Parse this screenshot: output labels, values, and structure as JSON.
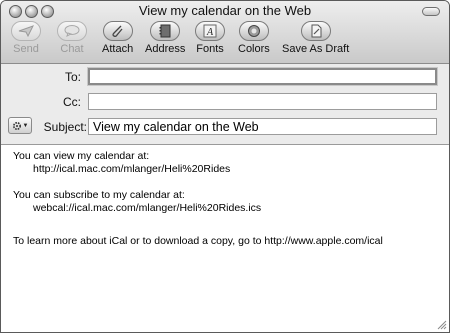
{
  "window": {
    "title": "View my calendar on the Web"
  },
  "toolbar": {
    "send": "Send",
    "chat": "Chat",
    "attach": "Attach",
    "address": "Address",
    "fonts": "Fonts",
    "colors": "Colors",
    "save_as_draft": "Save As Draft"
  },
  "headers": {
    "to_label": "To:",
    "to_value": "",
    "cc_label": "Cc:",
    "cc_value": "",
    "subject_label": "Subject:",
    "subject_value": "View my calendar on the Web"
  },
  "message": {
    "line1": "You can view my calendar at:",
    "url1": "http://ical.mac.com/mlanger/Heli%20Rides",
    "line2": "You can subscribe to my calendar at:",
    "url2": "webcal://ical.mac.com/mlanger/Heli%20Rides.ics",
    "line3": "To learn more about iCal or to download a copy, go to http://www.apple.com/ical"
  }
}
